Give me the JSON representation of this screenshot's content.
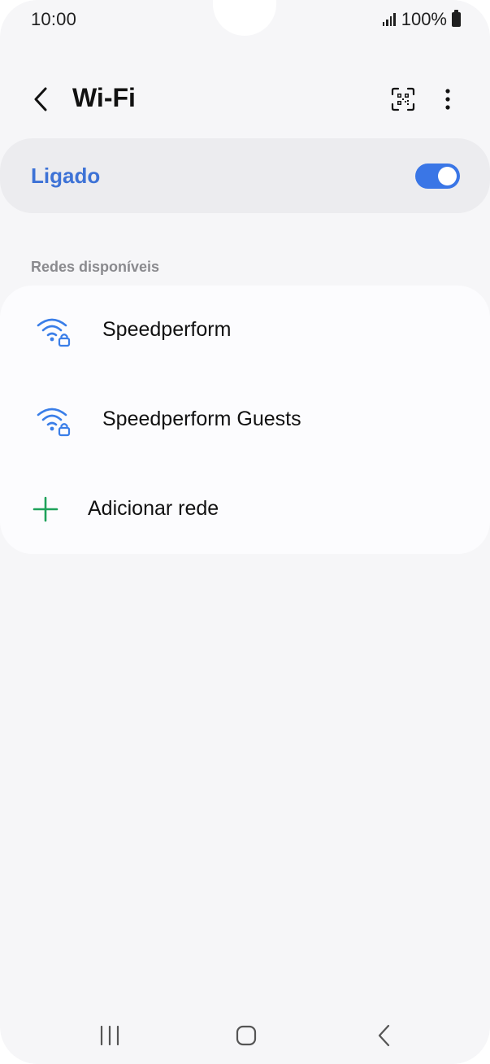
{
  "status_bar": {
    "time": "10:00",
    "battery": "100%"
  },
  "header": {
    "title": "Wi-Fi",
    "back_icon": "chevron-left-icon",
    "qr_icon": "qr-code-icon",
    "more_icon": "more-vertical-icon"
  },
  "wifi_toggle": {
    "label": "Ligado",
    "state": true,
    "label_color": "#3d72d6",
    "switch_color": "#3a76e6"
  },
  "available_networks": {
    "section_title": "Redes disponíveis",
    "networks": [
      {
        "name": "Speedperform",
        "icon": "wifi-lock-icon"
      },
      {
        "name": "Speedperform Guests",
        "icon": "wifi-lock-icon"
      }
    ],
    "add_network": {
      "label": "Adicionar rede",
      "icon": "plus-icon",
      "icon_color": "#1ea25a"
    }
  },
  "navigation_bar": {
    "recents_icon": "recents-icon",
    "home_icon": "home-icon",
    "back_icon": "back-icon"
  },
  "colors": {
    "background": "#f6f6f8",
    "accent": "#3a76e6",
    "wifi_icon": "#3a7ee8"
  }
}
